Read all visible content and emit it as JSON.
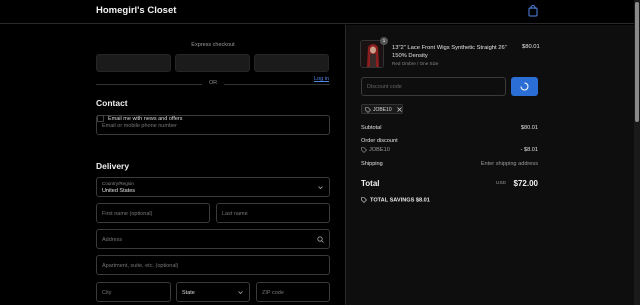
{
  "header": {
    "brand": "Homegirl's Closet",
    "cart_icon": "shopping-bag-icon"
  },
  "express": {
    "label": "Express checkout",
    "or": "OR"
  },
  "contact": {
    "title": "Contact",
    "login": "Log in",
    "email_placeholder": "Email or mobile phone number",
    "newsletter": "Email me with news and offers"
  },
  "delivery": {
    "title": "Delivery",
    "country_label": "Country/Region",
    "country_value": "United States",
    "first_name": "First name (optional)",
    "last_name": "Last name",
    "address": "Address",
    "apartment": "Apartment, suite, etc. (optional)",
    "city": "City",
    "state": "State",
    "zip": "ZIP code"
  },
  "order": {
    "quantity": "1",
    "product_title": "13\"2\" Lace Front Wigs Synthetic Straight 26\" 150% Density",
    "product_subtitle": "Red Ombre / One Size",
    "product_price": "$80.01",
    "discount_placeholder": "Discount code",
    "discount_tag": "JOBE10",
    "subtotal_label": "Subtotal",
    "subtotal_value": "$80.01",
    "order_discount_label": "Order discount",
    "order_discount_code": "JOBE10",
    "order_discount_value": "- $8.01",
    "shipping_label": "Shipping",
    "shipping_value": "Enter shipping address",
    "total_label": "Total",
    "currency": "USD",
    "total_value": "$72.00",
    "savings": "TOTAL SAVINGS $8.01"
  },
  "colors": {
    "accent": "#2b6fd6",
    "link": "#4f86e8",
    "background": "#000000",
    "panel": "#0e0e0e"
  }
}
